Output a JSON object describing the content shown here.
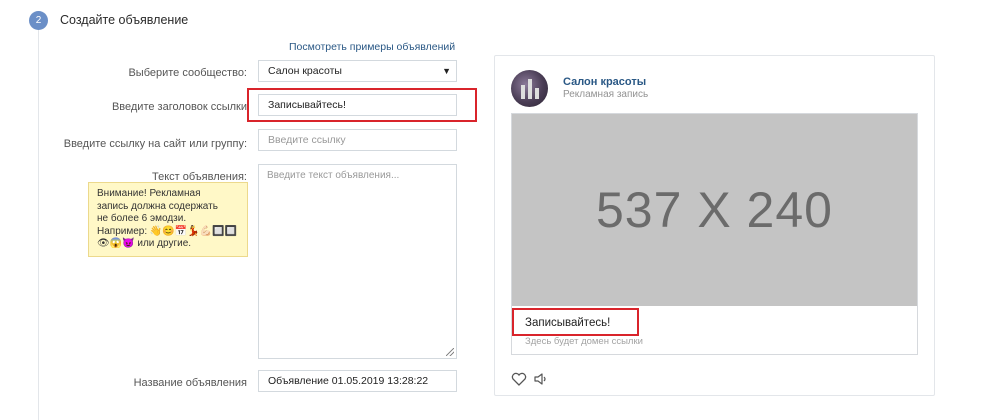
{
  "step": {
    "number": "2",
    "title": "Создайте объявление"
  },
  "form": {
    "examples_link": "Посмотреть примеры объявлений",
    "community": {
      "label": "Выберите сообщество:",
      "value": "Салон красоты"
    },
    "headline": {
      "label": "Введите заголовок ссылки",
      "value": "Записывайтесь!"
    },
    "link": {
      "label": "Введите ссылку на сайт или группу:",
      "placeholder": "Введите ссылку"
    },
    "text": {
      "label": "Текст объявления:",
      "placeholder": "Введите текст объявления..."
    },
    "warning": {
      "line1": "Внимание! Рекламная",
      "line2": "запись должна содержать",
      "line3": "не более 6 эмодзи.",
      "line4_prefix": "Например:",
      "emoji_row1": "👋😊📅💃💪🏻🔲🔲",
      "emoji_row2": "👁😱😈",
      "line5_suffix": "или другие."
    },
    "ad_name": {
      "label": "Название объявления",
      "value": "Объявление 01.05.2019 13:28:22"
    }
  },
  "preview": {
    "community_name": "Салон красоты",
    "subtitle": "Рекламная запись",
    "image_placeholder": "537 X 240",
    "title": "Записывайтесь!",
    "domain_hint": "Здесь будет домен ссылки"
  },
  "colors": {
    "accent_link": "#2a5885",
    "highlight_border": "#d9242b",
    "step_circle": "#6b8fc7",
    "warning_bg": "#fff8c7"
  },
  "icons": {
    "like": "heart-icon",
    "share": "speaker-icon",
    "select_arrow": "caret-down-icon"
  }
}
